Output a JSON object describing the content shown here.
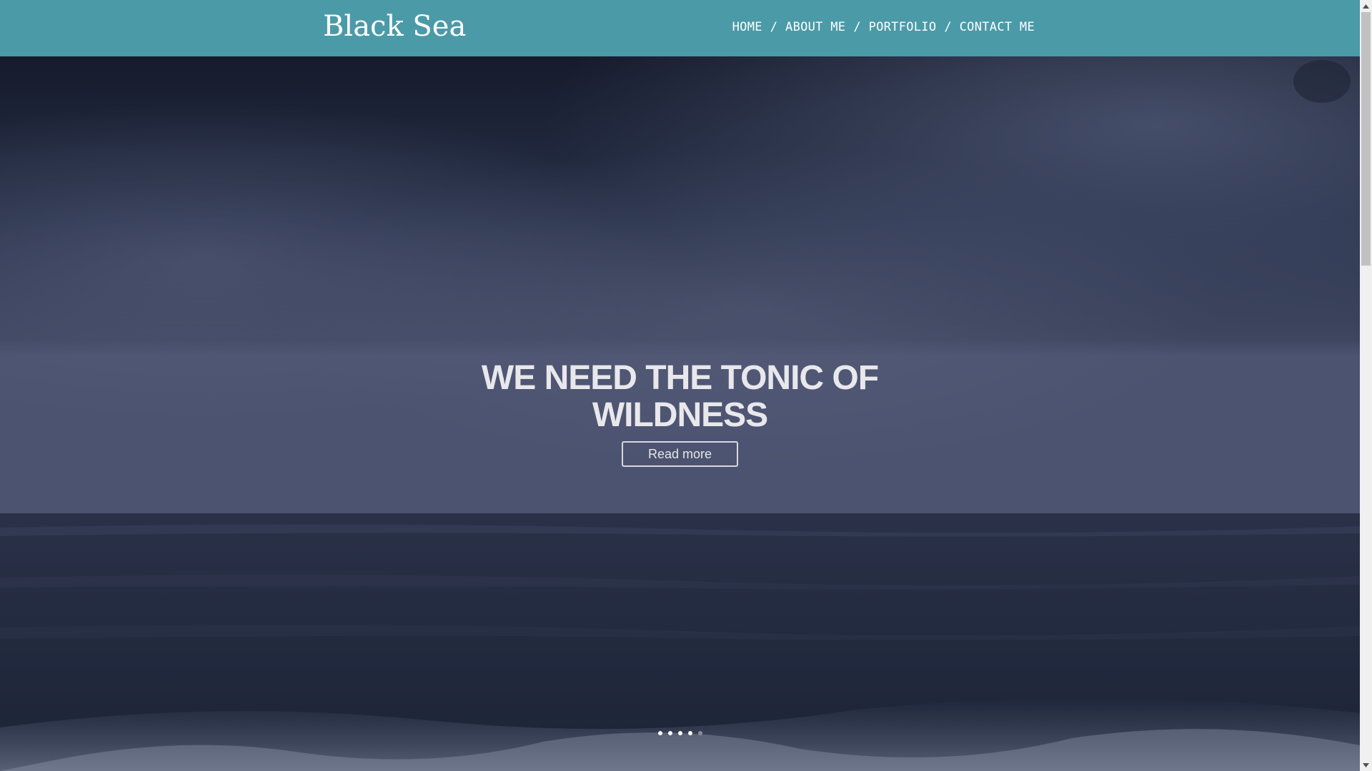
{
  "header": {
    "logo": "Black Sea",
    "nav": [
      {
        "label": "HOME"
      },
      {
        "label": "ABOUT ME"
      },
      {
        "label": "PORTFOLIO"
      },
      {
        "label": "CONTACT ME"
      }
    ],
    "separator": "/",
    "background_color": "#4b9aa8"
  },
  "hero": {
    "headline": "WE NEED THE TONIC OF WILDNESS",
    "button_label": "Read more",
    "slides_total": 5,
    "active_slide": 5
  },
  "scrollbar": {
    "up_icon": "triangle-up",
    "down_icon": "triangle-down"
  }
}
